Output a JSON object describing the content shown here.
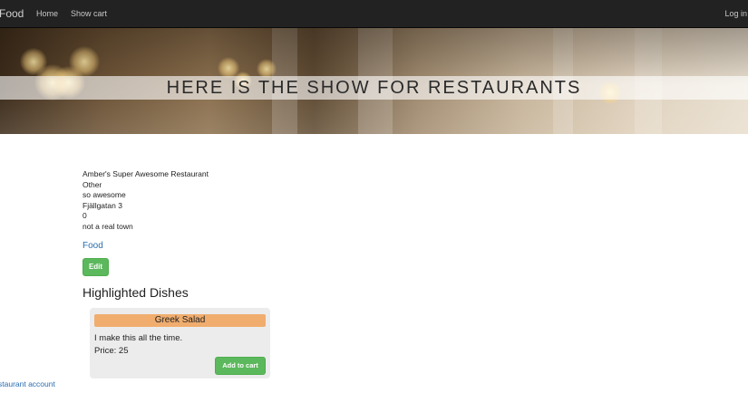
{
  "navbar": {
    "brand": "Food",
    "links": [
      {
        "label": "Home"
      },
      {
        "label": "Show cart"
      }
    ],
    "login_label": "Log in"
  },
  "hero": {
    "title": "HERE IS THE SHOW FOR RESTAURANTS"
  },
  "restaurant": {
    "name": "Amber's Super Awesome Restaurant",
    "category": "Other",
    "description": "so awesome",
    "address": "Fjällgatan 3",
    "zip": "0",
    "town": "not a real town"
  },
  "food_link": "Food",
  "edit_label": "Edit",
  "highlighted": {
    "title": "Highlighted Dishes",
    "dishes": [
      {
        "name": "Greek Salad",
        "description": "I make this all the time.",
        "price_text": "Price: 25",
        "add_label": "Add to cart"
      }
    ]
  },
  "footer": {
    "account_link": "staurant account"
  },
  "colors": {
    "navbar": "#222222",
    "button": "#5cb85c",
    "dish_header": "#f0ad6e",
    "link": "#2a6db0"
  }
}
